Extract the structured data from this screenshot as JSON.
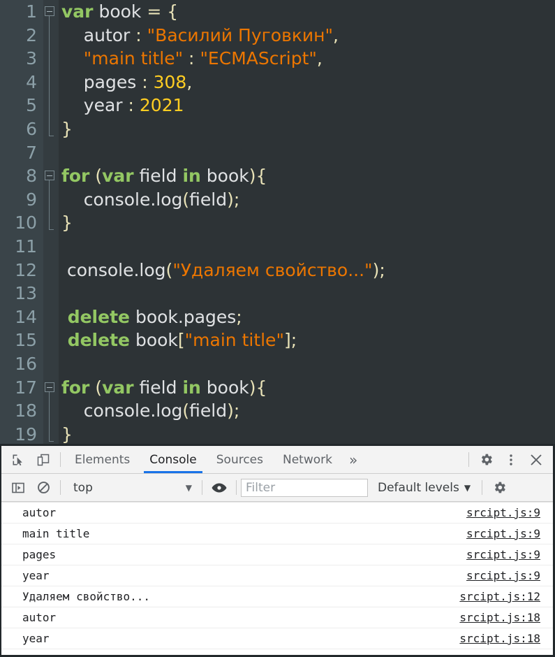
{
  "editor": {
    "language": "javascript",
    "first_line": 1,
    "colors": {
      "background": "#2d3336",
      "gutter_background": "#3a4449",
      "gutter_text": "#8ca0a8",
      "keyword": "#93c763",
      "string": "#ec7600",
      "number": "#ffcd22",
      "plain": "#e0e2e4",
      "punctuation": "#e8e2b7"
    },
    "lines": [
      {
        "n": "1",
        "fold": "start",
        "tokens": [
          {
            "t": "kw",
            "v": "var"
          },
          {
            "t": "plain",
            "v": " book "
          },
          {
            "t": "op",
            "v": "="
          },
          {
            "t": "plain",
            "v": " "
          },
          {
            "t": "punc",
            "v": "{"
          }
        ]
      },
      {
        "n": "2",
        "tokens": [
          {
            "t": "plain",
            "v": "    autor "
          },
          {
            "t": "punc",
            "v": ":"
          },
          {
            "t": "plain",
            "v": " "
          },
          {
            "t": "str",
            "v": "\"Василий Пуговкин\""
          },
          {
            "t": "punc",
            "v": ","
          }
        ]
      },
      {
        "n": "3",
        "tokens": [
          {
            "t": "plain",
            "v": "    "
          },
          {
            "t": "str",
            "v": "\"main title\""
          },
          {
            "t": "plain",
            "v": " "
          },
          {
            "t": "punc",
            "v": ":"
          },
          {
            "t": "plain",
            "v": " "
          },
          {
            "t": "str",
            "v": "\"ECMAScript\""
          },
          {
            "t": "punc",
            "v": ","
          }
        ]
      },
      {
        "n": "4",
        "tokens": [
          {
            "t": "plain",
            "v": "    pages "
          },
          {
            "t": "punc",
            "v": ":"
          },
          {
            "t": "plain",
            "v": " "
          },
          {
            "t": "num",
            "v": "308"
          },
          {
            "t": "punc",
            "v": ","
          }
        ]
      },
      {
        "n": "5",
        "tokens": [
          {
            "t": "plain",
            "v": "    year "
          },
          {
            "t": "punc",
            "v": ":"
          },
          {
            "t": "plain",
            "v": " "
          },
          {
            "t": "num",
            "v": "2021"
          }
        ]
      },
      {
        "n": "6",
        "fold": "end",
        "tokens": [
          {
            "t": "punc",
            "v": "}"
          }
        ]
      },
      {
        "n": "7",
        "tokens": []
      },
      {
        "n": "8",
        "fold": "start",
        "tokens": [
          {
            "t": "kw",
            "v": "for"
          },
          {
            "t": "plain",
            "v": " "
          },
          {
            "t": "punc",
            "v": "("
          },
          {
            "t": "kw",
            "v": "var"
          },
          {
            "t": "plain",
            "v": " field "
          },
          {
            "t": "kw",
            "v": "in"
          },
          {
            "t": "plain",
            "v": " book"
          },
          {
            "t": "punc",
            "v": "){"
          }
        ]
      },
      {
        "n": "9",
        "tokens": [
          {
            "t": "plain",
            "v": "    console.log"
          },
          {
            "t": "punc",
            "v": "("
          },
          {
            "t": "plain",
            "v": "field"
          },
          {
            "t": "punc",
            "v": ");"
          }
        ]
      },
      {
        "n": "10",
        "fold": "end",
        "tokens": [
          {
            "t": "punc",
            "v": "}"
          }
        ]
      },
      {
        "n": "11",
        "tokens": []
      },
      {
        "n": "12",
        "tokens": [
          {
            "t": "plain",
            "v": " console.log"
          },
          {
            "t": "punc",
            "v": "("
          },
          {
            "t": "str",
            "v": "\"Удаляем свойство...\""
          },
          {
            "t": "punc",
            "v": ");"
          }
        ]
      },
      {
        "n": "13",
        "tokens": []
      },
      {
        "n": "14",
        "tokens": [
          {
            "t": "kw",
            "v": " delete"
          },
          {
            "t": "plain",
            "v": " book.pages"
          },
          {
            "t": "punc",
            "v": ";"
          }
        ]
      },
      {
        "n": "15",
        "tokens": [
          {
            "t": "kw",
            "v": " delete"
          },
          {
            "t": "plain",
            "v": " book"
          },
          {
            "t": "punc",
            "v": "["
          },
          {
            "t": "str",
            "v": "\"main title\""
          },
          {
            "t": "punc",
            "v": "];"
          }
        ]
      },
      {
        "n": "16",
        "tokens": []
      },
      {
        "n": "17",
        "fold": "start",
        "tokens": [
          {
            "t": "kw",
            "v": "for"
          },
          {
            "t": "plain",
            "v": " "
          },
          {
            "t": "punc",
            "v": "("
          },
          {
            "t": "kw",
            "v": "var"
          },
          {
            "t": "plain",
            "v": " field "
          },
          {
            "t": "kw",
            "v": "in"
          },
          {
            "t": "plain",
            "v": " book"
          },
          {
            "t": "punc",
            "v": "){"
          }
        ]
      },
      {
        "n": "18",
        "tokens": [
          {
            "t": "plain",
            "v": "    console.log"
          },
          {
            "t": "punc",
            "v": "("
          },
          {
            "t": "plain",
            "v": "field"
          },
          {
            "t": "punc",
            "v": ");"
          }
        ]
      },
      {
        "n": "19",
        "fold": "end",
        "tokens": [
          {
            "t": "punc",
            "v": "}"
          }
        ]
      }
    ]
  },
  "devtools": {
    "left_icons": [
      {
        "name": "inspect-element-icon",
        "title": "Inspect element"
      },
      {
        "name": "device-toolbar-icon",
        "title": "Toggle device toolbar"
      }
    ],
    "tabs": [
      {
        "label": "Elements",
        "active": false
      },
      {
        "label": "Console",
        "active": true
      },
      {
        "label": "Sources",
        "active": false
      },
      {
        "label": "Network",
        "active": false
      }
    ],
    "more_tabs_label": "»",
    "right_icons": [
      {
        "name": "settings-gear-icon",
        "glyph": "gear"
      },
      {
        "name": "kebab-menu-icon",
        "glyph": "kebab"
      },
      {
        "name": "close-devtools-icon",
        "glyph": "close"
      }
    ],
    "accent_color": "#1a73e8",
    "toolbar": {
      "sidebar_toggle_name": "console-sidebar-toggle-icon",
      "clear_console_name": "clear-console-icon",
      "context_selected": "top",
      "context_caret": "▼",
      "eye_icon_name": "live-expression-eye-icon",
      "filter_value": "",
      "filter_placeholder": "Filter",
      "levels_label": "Default levels",
      "levels_caret": "▼",
      "settings_gear_name": "console-settings-gear-icon"
    },
    "console_messages": [
      {
        "text": "autor",
        "source": "srcipt.js:9"
      },
      {
        "text": "main title",
        "source": "srcipt.js:9"
      },
      {
        "text": "pages",
        "source": "srcipt.js:9"
      },
      {
        "text": "year",
        "source": "srcipt.js:9"
      },
      {
        "text": "Удаляем свойство...",
        "source": "srcipt.js:12"
      },
      {
        "text": "autor",
        "source": "srcipt.js:18"
      },
      {
        "text": "year",
        "source": "srcipt.js:18"
      }
    ]
  }
}
